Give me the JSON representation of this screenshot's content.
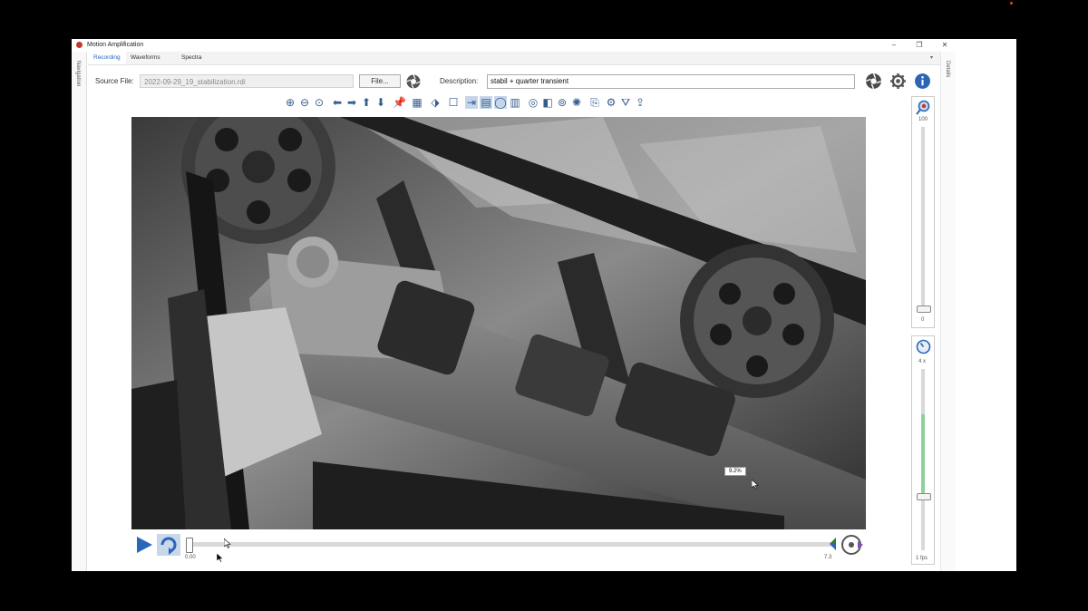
{
  "window": {
    "title": "Motion Amplification",
    "controls": {
      "minimize": "–",
      "maximize": "❐",
      "close": "✕"
    }
  },
  "tabs": [
    {
      "label": "Recording",
      "active": true
    },
    {
      "label": "Waveforms",
      "active": false
    },
    {
      "label": "Spectra",
      "active": false
    }
  ],
  "side": {
    "left_label": "Navigation",
    "right_label": "Details"
  },
  "source": {
    "label": "Source File:",
    "value": "2022-09-29_19_stabilization.rdi",
    "file_button": "File..."
  },
  "description": {
    "label": "Description:",
    "value": "stabil + quarter transient"
  },
  "header_icons": [
    "camera-icon",
    "gear-icon",
    "info-icon"
  ],
  "toolbar": [
    "zoom-in-icon",
    "zoom-out-icon",
    "zoom-fit-icon",
    "arrow-left-icon",
    "arrow-right-icon",
    "arrow-up-icon",
    "arrow-down-icon",
    "pin-icon",
    "grid-icon",
    "region-icon",
    "selection-box-icon",
    "motion-vector-icon",
    "area-icon",
    "ellipse-icon",
    "chart-icon",
    "circle-icon",
    "gradient-icon",
    "filter-pattern-icon",
    "color-wheel-icon",
    "copy-icon",
    "settings-gear-icon",
    "funnel-icon",
    "export-icon"
  ],
  "video": {
    "tooltip": "9.2%"
  },
  "playback": {
    "start_time": "0.00",
    "end_time": "7.3",
    "progress": 0.0
  },
  "amplification_slider": {
    "max_label": "100",
    "min_label": "0",
    "value": 0
  },
  "framerate_slider": {
    "top_label": "4 x",
    "bottom_label": "1 fps",
    "value_fraction": 0.3
  },
  "colors": {
    "accent": "#2a66b8",
    "slider_fill": "#8fcf9c",
    "toolbar_icons": "#345d8c"
  }
}
